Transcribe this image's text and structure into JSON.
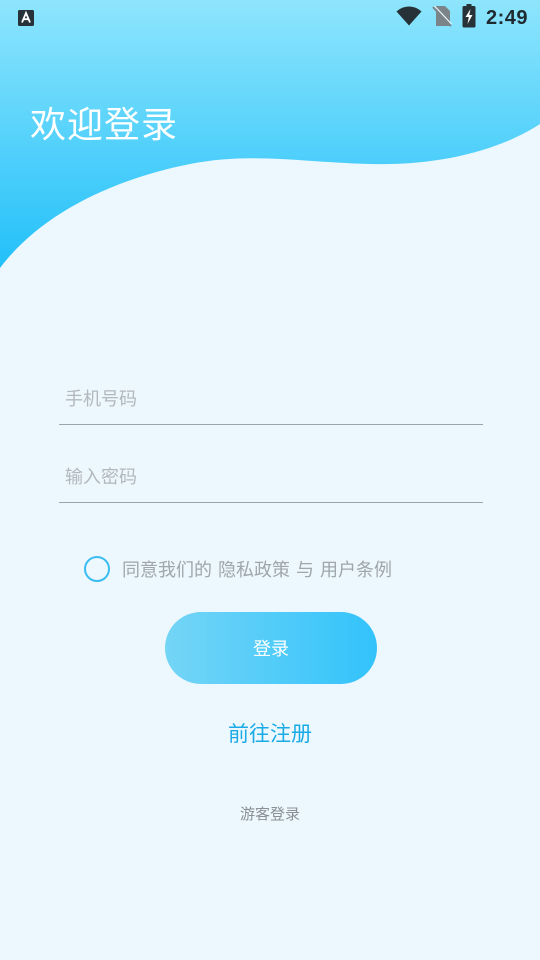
{
  "status_bar": {
    "time": "2:49",
    "notification_icon": "a-letter-notification-icon",
    "wifi_icon": "wifi-icon",
    "no_sim_icon": "no-sim-icon",
    "battery_icon": "battery-charging-icon"
  },
  "header": {
    "title": "欢迎登录"
  },
  "form": {
    "phone_placeholder": "手机号码",
    "password_placeholder": "输入密码",
    "agreement": {
      "prefix": "同意我们的",
      "privacy_link": "隐私政策",
      "conjunction": "与",
      "terms_link": "用户条例"
    },
    "login_label": "登录",
    "register_label": "前往注册",
    "guest_label": "游客登录"
  },
  "colors": {
    "background": "#ECF8FE",
    "header_gradient_top": "#8EE5FC",
    "header_gradient_bottom": "#22C0FA",
    "button_gradient_start": "#74D5F6",
    "button_gradient_end": "#32C3FB",
    "accent_link": "#1AABE6",
    "checkbox_border": "#3CBDF2"
  }
}
